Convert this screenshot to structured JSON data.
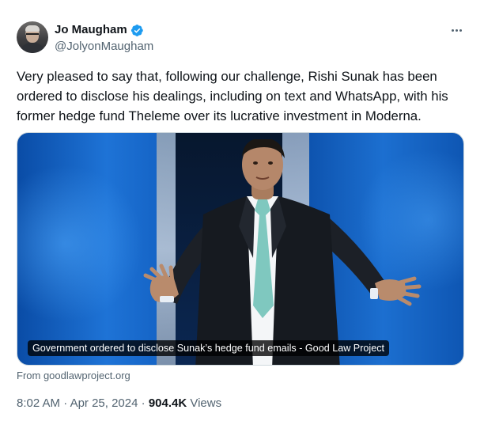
{
  "author": {
    "display_name": "Jo Maugham",
    "handle": "@JolyonMaugham",
    "verified": true
  },
  "tweet": {
    "text": "Very pleased to say that, following our challenge, Rishi Sunak has been ordered to disclose his dealings, including on text and WhatsApp, with his former hedge fund Theleme over its lucrative investment in Moderna."
  },
  "card": {
    "caption": "Government ordered to disclose Sunak’s hedge fund emails - Good Law Project",
    "source": "From goodlawproject.org"
  },
  "meta": {
    "time": "8:02 AM",
    "separator": "·",
    "date": "Apr 25, 2024",
    "views_count": "904.4K",
    "views_label": "Views"
  },
  "colors": {
    "verified_blue": "#1d9bf0",
    "secondary_text": "#536471",
    "primary_text": "#0f1419"
  },
  "icons": {
    "verified": "verified-badge-icon",
    "more": "more-options-icon"
  }
}
